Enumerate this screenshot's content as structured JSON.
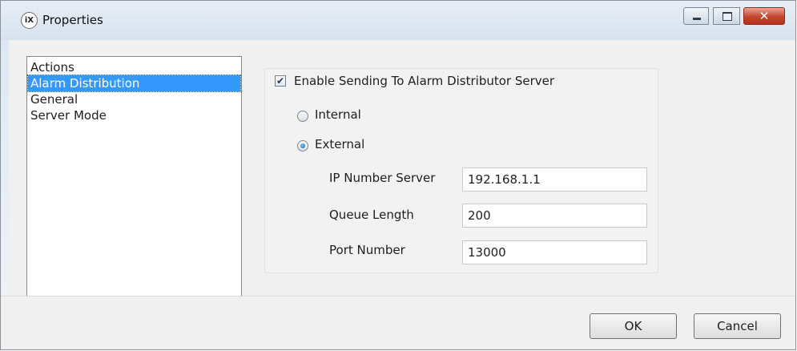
{
  "window": {
    "title": "Properties",
    "app_icon_text": "iX",
    "close_glyph": "✕",
    "min_icon": "minimize-icon",
    "max_icon": "maximize-icon",
    "close_icon": "close-icon"
  },
  "nav": {
    "items": [
      {
        "label": "Actions",
        "selected": false
      },
      {
        "label": "Alarm Distribution",
        "selected": true
      },
      {
        "label": "General",
        "selected": false
      },
      {
        "label": "Server Mode",
        "selected": false
      }
    ]
  },
  "alarm": {
    "enable_label": "Enable Sending To Alarm Distributor Server",
    "enable_checked": true,
    "check_mark": "✔",
    "internal_label": "Internal",
    "external_label": "External",
    "selected_mode": "External",
    "fields": [
      {
        "label": "IP Number Server",
        "value": "192.168.1.1"
      },
      {
        "label": "Queue Length",
        "value": "200"
      },
      {
        "label": "Port Number",
        "value": "13000"
      }
    ]
  },
  "footer": {
    "ok_label": "OK",
    "cancel_label": "Cancel"
  },
  "colors": {
    "selection": "#3399ff",
    "close_button": "#c4452f",
    "dialog_bg": "#f0f0f0"
  }
}
